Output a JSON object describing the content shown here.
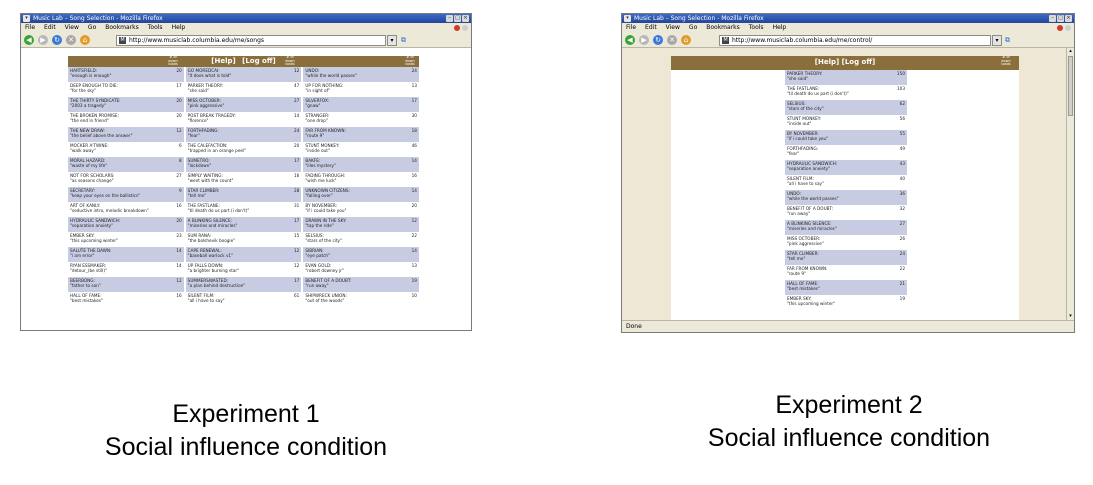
{
  "browser": {
    "window_title": "Music Lab – Song Selection - Mozilla Firefox",
    "menu": [
      "File",
      "Edit",
      "View",
      "Go",
      "Bookmarks",
      "Tools",
      "Help"
    ],
    "go_icon": "go-arrow-icon",
    "colors": {
      "header_brown": "#8a6f3d",
      "row_blue": "#c7cce2",
      "page_bg": "#efe7d6"
    }
  },
  "exp1": {
    "url": "http://www.musiclab.columbia.edu/me/songs",
    "help": "[Help]",
    "logoff": "[Log off]",
    "dl_header": "# of down loads",
    "rows": [
      [
        {
          "band": "HARTSFIELD:",
          "song": "\"enough is enough\"",
          "dl": "20"
        },
        {
          "band": "GO MOREDCAI:",
          "song": "\"it does what is told\"",
          "dl": "12"
        },
        {
          "band": "UNDO:",
          "song": "\"while the world passes\"",
          "dl": "24"
        }
      ],
      [
        {
          "band": "DEEP ENOUGH TO DIE:",
          "song": "\"for the sky\"",
          "dl": "17"
        },
        {
          "band": "PARKER THEORY:",
          "song": "\"she said\"",
          "dl": "47"
        },
        {
          "band": "UP FOR NOTHING:",
          "song": "\"in sight of\"",
          "dl": "13"
        }
      ],
      [
        {
          "band": "THE THIRTY SYNDICATE:",
          "song": "\"2003 a tragedy\"",
          "dl": "20"
        },
        {
          "band": "MISS OCTOBER:",
          "song": "\"pink aggressive\"",
          "dl": "27"
        },
        {
          "band": "SILVERFOX:",
          "song": "\"gnaw\"",
          "dl": "17"
        }
      ],
      [
        {
          "band": "THE BROKEN PROMISE:",
          "song": "\"the end in friend\"",
          "dl": "20"
        },
        {
          "band": "POST BREAK TRAGEDY:",
          "song": "\"florence\"",
          "dl": "14"
        },
        {
          "band": "STRANGER:",
          "song": "\"one drop\"",
          "dl": "30"
        }
      ],
      [
        {
          "band": "THE NEW DRAW:",
          "song": "\"the belief above the answer\"",
          "dl": "12"
        },
        {
          "band": "FORTHFADING:",
          "song": "\"fear\"",
          "dl": "24"
        },
        {
          "band": "FAR FROM KNOWN:",
          "song": "\"route 9\"",
          "dl": "18"
        }
      ],
      [
        {
          "band": "MOCKER A'TWINE:",
          "song": "\"walk away\"",
          "dl": "6"
        },
        {
          "band": "THE CALEFACTION:",
          "song": "\"trapped in an orange peel\"",
          "dl": "20"
        },
        {
          "band": "STUNT MONKEY:",
          "song": "\"inside out\"",
          "dl": "46"
        }
      ],
      [
        {
          "band": "MORAL HAZARD:",
          "song": "\"waste of my life\"",
          "dl": "8"
        },
        {
          "band": "SUMETRO:",
          "song": "\"lockdown\"",
          "dl": "17"
        },
        {
          "band": "BAKFE:",
          "song": "\"illes mystery\"",
          "dl": "14"
        }
      ],
      [
        {
          "band": "NOT FOR SCHOLARS:",
          "song": "\"as seasons change\"",
          "dl": "27"
        },
        {
          "band": "SIMPLY WAITING:",
          "song": "\"went with the count\"",
          "dl": "16"
        },
        {
          "band": "FADING THROUGH:",
          "song": "\"wish me luck\"",
          "dl": "16"
        }
      ],
      [
        {
          "band": "SECRETARY:",
          "song": "\"keep your eyes on the ballistics\"",
          "dl": "9"
        },
        {
          "band": "STAR CLIMBER:",
          "song": "\"tell me\"",
          "dl": "28"
        },
        {
          "band": "UNKNOWN CITIZENS:",
          "song": "\"falling over\"",
          "dl": "14"
        }
      ],
      [
        {
          "band": "ART OF KANLY:",
          "song": "\"seductive intro, melodic breakdown\"",
          "dl": "16"
        },
        {
          "band": "THE FASTLANE:",
          "song": "\"til death do us part (i don't)\"",
          "dl": "31"
        },
        {
          "band": "BY NOVEMBER:",
          "song": "\"if i could take you\"",
          "dl": "20"
        }
      ],
      [
        {
          "band": "HYDRAULIC SANDWICH:",
          "song": "\"separation anxiety\"",
          "dl": "20"
        },
        {
          "band": "A BLINKING SILENCE:",
          "song": "\"miseries and miracles\"",
          "dl": "17"
        },
        {
          "band": "DRAWN IN THE SKY:",
          "song": "\"tap the ride\"",
          "dl": "12"
        }
      ],
      [
        {
          "band": "EMBER SKY:",
          "song": "\"this upcoming winter\"",
          "dl": "23"
        },
        {
          "band": "SUM RANA:",
          "song": "\"the bolshevik boogie\"",
          "dl": "15"
        },
        {
          "band": "SELSIUS:",
          "song": "\"stars of the city\"",
          "dl": "22"
        }
      ],
      [
        {
          "band": "SALUTE THE DAWN:",
          "song": "\"i am error\"",
          "dl": "14"
        },
        {
          "band": "CAPE RENEWAL:",
          "song": "\"baseball warlock v1\"",
          "dl": "12"
        },
        {
          "band": "SIBRIAN:",
          "song": "\"eye patch\"",
          "dl": "14"
        }
      ],
      [
        {
          "band": "RYAN ESSMAKER:",
          "song": "\"detour_(be still)\"",
          "dl": "14"
        },
        {
          "band": "UP FALLS DOWN:",
          "song": "\"a brighter burning star\"",
          "dl": "12"
        },
        {
          "band": "EVAN GOLD:",
          "song": "\"robert downey jr\"",
          "dl": "13"
        }
      ],
      [
        {
          "band": "BEERBONG:",
          "song": "\"father to son\"",
          "dl": "12"
        },
        {
          "band": "SUMMERSWASTED:",
          "song": "\"a plan behind destruction\"",
          "dl": "17"
        },
        {
          "band": "BENEFIT OF A DOUBT:",
          "song": "\"run away\"",
          "dl": "19"
        }
      ],
      [
        {
          "band": "HALL OF FAME:",
          "song": "\"best mistakes\"",
          "dl": "16"
        },
        {
          "band": "SILENT FILM:",
          "song": "\"all i have to say\"",
          "dl": "61"
        },
        {
          "band": "SHIPWRECK UNION:",
          "song": "\"out of the woods\"",
          "dl": "10"
        }
      ]
    ]
  },
  "exp2": {
    "url": "http://www.musiclab.columbia.edu/me/control/",
    "help": "[Help]",
    "logoff": "[Log off]",
    "dl_header": "# of down loads",
    "status": "Done",
    "rows": [
      {
        "band": "PARKER THEORY:",
        "song": "\"she said\"",
        "dl": "150"
      },
      {
        "band": "THE FASTLANE:",
        "song": "\"til death do us part (i don't)\"",
        "dl": "103"
      },
      {
        "band": "SELSIUS:",
        "song": "\"stars of the city\"",
        "dl": "62"
      },
      {
        "band": "STUNT MONKEY:",
        "song": "\"inside out\"",
        "dl": "56"
      },
      {
        "band": "BY NOVEMBER:",
        "song": "\"if i could take you\"",
        "dl": "55"
      },
      {
        "band": "FORTHFADING:",
        "song": "\"fear\"",
        "dl": "49"
      },
      {
        "band": "HYDRAULIC SANDWICH:",
        "song": "\"separation anxiety\"",
        "dl": "43"
      },
      {
        "band": "SILENT FILM:",
        "song": "\"all i have to say\"",
        "dl": "40"
      },
      {
        "band": "UNDO:",
        "song": "\"while the world passes\"",
        "dl": "36"
      },
      {
        "band": "BENEFIT OF A DOUBT:",
        "song": "\"run away\"",
        "dl": "32"
      },
      {
        "band": "A BLINKING SILENCE:",
        "song": "\"miseries and miracles\"",
        "dl": "27"
      },
      {
        "band": "MISS OCTOBER:",
        "song": "\"pink aggressive\"",
        "dl": "26"
      },
      {
        "band": "STAR CLIMBER:",
        "song": "\"tell me\"",
        "dl": "24"
      },
      {
        "band": "FAR FROM KNOWN:",
        "song": "\"route 9\"",
        "dl": "22"
      },
      {
        "band": "HALL OF FAME:",
        "song": "\"best mistakes\"",
        "dl": "21"
      },
      {
        "band": "EMBER SKY:",
        "song": "\"this upcoming winter\"",
        "dl": "19"
      }
    ]
  },
  "captions": {
    "exp1_line1": "Experiment 1",
    "exp1_line2": "Social influence condition",
    "exp2_line1": "Experiment 2",
    "exp2_line2": "Social influence condition"
  }
}
